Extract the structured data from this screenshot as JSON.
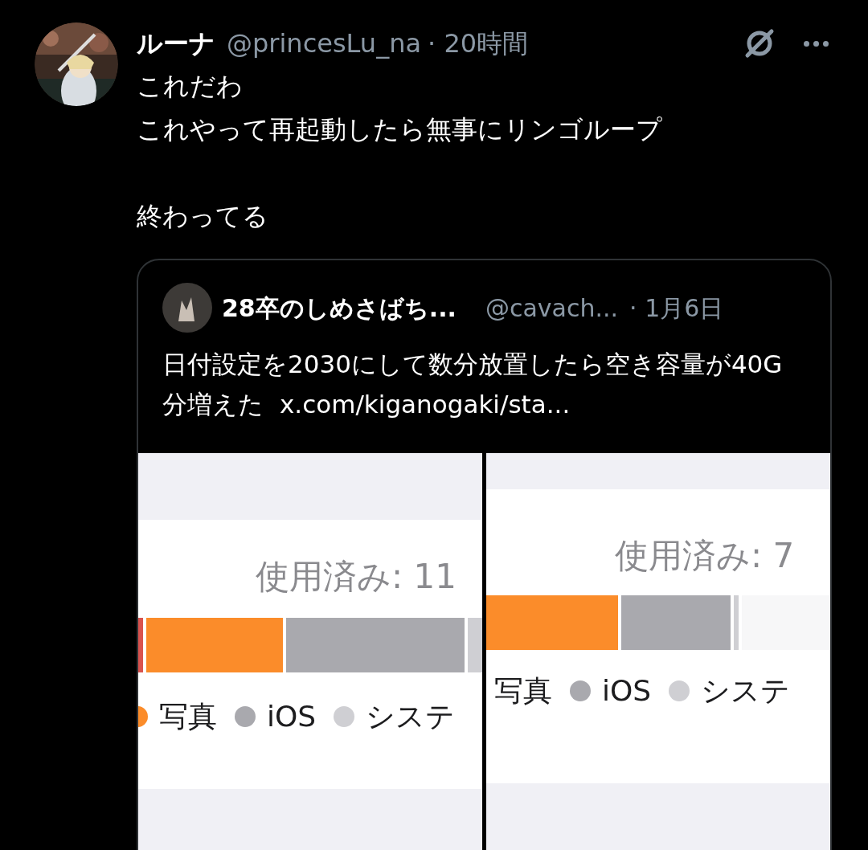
{
  "post": {
    "author": {
      "name": "ルーナ",
      "handle": "@princesLu_na",
      "time": "· 20時間"
    },
    "paragraphs": [
      [
        "これだわ",
        "これやって再起動したら無事にリンゴループ"
      ],
      [
        "終わってる"
      ]
    ],
    "quote": {
      "author": {
        "name": "28卒のしめさばち...",
        "handle": "@cavach...",
        "time": "· 1月6日"
      },
      "text": "日付設定を2030にして数分放置したら空き容量が40G分増えた",
      "link": "x.com/kiganogaki/sta...",
      "screenshots": [
        {
          "used": "使用済み: 11",
          "segments": [
            {
              "color": "#d9534f"
            },
            {
              "color": "#fb8c2a"
            },
            {
              "color": "#a9a9ae"
            },
            {
              "color": "#cfcfd3"
            }
          ],
          "legend": [
            {
              "label": "写真",
              "color": "#fb8c2a"
            },
            {
              "label": "iOS",
              "color": "#a9a9ae"
            },
            {
              "label": "システ",
              "color": "#cfcfd3"
            }
          ]
        },
        {
          "used": "使用済み: 7",
          "segments": [
            {
              "color": "#fb8c2a"
            },
            {
              "color": "#a9a9ae"
            },
            {
              "color": "#cfcfd3"
            },
            {
              "color": "#f7f7f8"
            }
          ],
          "legend": [
            {
              "label": "写真"
            },
            {
              "label": "iOS",
              "color": "#a9a9ae"
            },
            {
              "label": "システ",
              "color": "#cfcfd3"
            }
          ]
        }
      ]
    }
  }
}
